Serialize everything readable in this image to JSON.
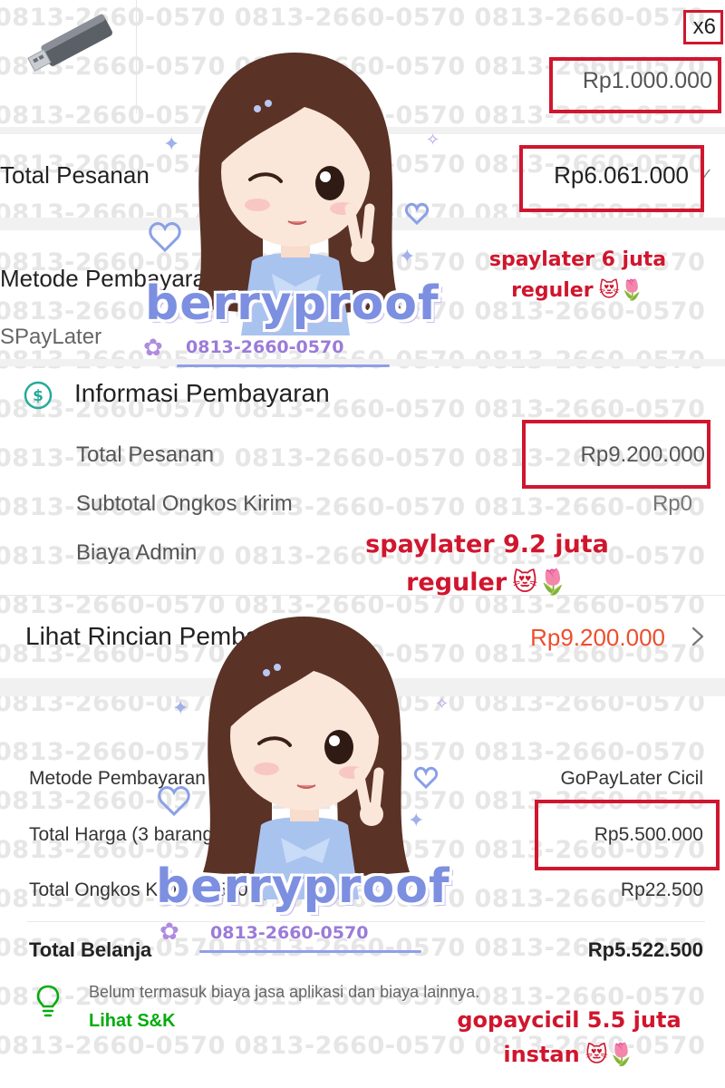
{
  "watermark": {
    "text": "0813-2660-0570 0813-2660-0570 0813-2660-0570"
  },
  "order_item": {
    "quantity": "x6",
    "price": "Rp1.000.000"
  },
  "order_total": {
    "label": "Total Pesanan",
    "value": "Rp6.061.000"
  },
  "payment_method_1": {
    "label": "Metode Pembayaran",
    "value": "SPayLater"
  },
  "payment_info": {
    "title": "Informasi Pembayaran",
    "rows": [
      {
        "label": "Total Pesanan",
        "value": "Rp9.200.000"
      },
      {
        "label": "Subtotal Ongkos Kirim",
        "value": "Rp0"
      },
      {
        "label": "Biaya Admin",
        "value": ""
      }
    ]
  },
  "details_link": {
    "label": "Lihat Rincian Pembayaran",
    "value": "Rp9.200.000"
  },
  "gopay": {
    "rows": [
      {
        "label": "Metode Pembayaran",
        "value": "GoPayLater Cicil"
      },
      {
        "label": "Total Harga (3 barang)",
        "value": "Rp5.500.000"
      },
      {
        "label": "Total Ongkos Kirim (1.500 g)",
        "value": "Rp22.500"
      },
      {
        "label": "Total Belanja",
        "value": "Rp5.522.500"
      }
    ],
    "note": "Belum termasuk biaya jasa aplikasi dan biaya lainnya.",
    "terms_link": "Lihat S&K"
  },
  "annotations": {
    "a1_line1": "spaylater 6 juta",
    "a1_line2": "reguler",
    "a2_line1": "spaylater 9.2 juta",
    "a2_line2": "reguler",
    "a3_line1": "gopaycicil 5.5 juta",
    "a3_line2": "instan",
    "emoji": "😻🌷"
  },
  "brand": {
    "name": "berryproof",
    "phone": "0813-2660-0570"
  },
  "colors": {
    "accent_red": "#d0162e",
    "price_orange": "#ee4d2d",
    "gopay_green": "#03ac0e",
    "brand_blue": "#7d8fe0",
    "spay_teal": "#26aa99"
  }
}
